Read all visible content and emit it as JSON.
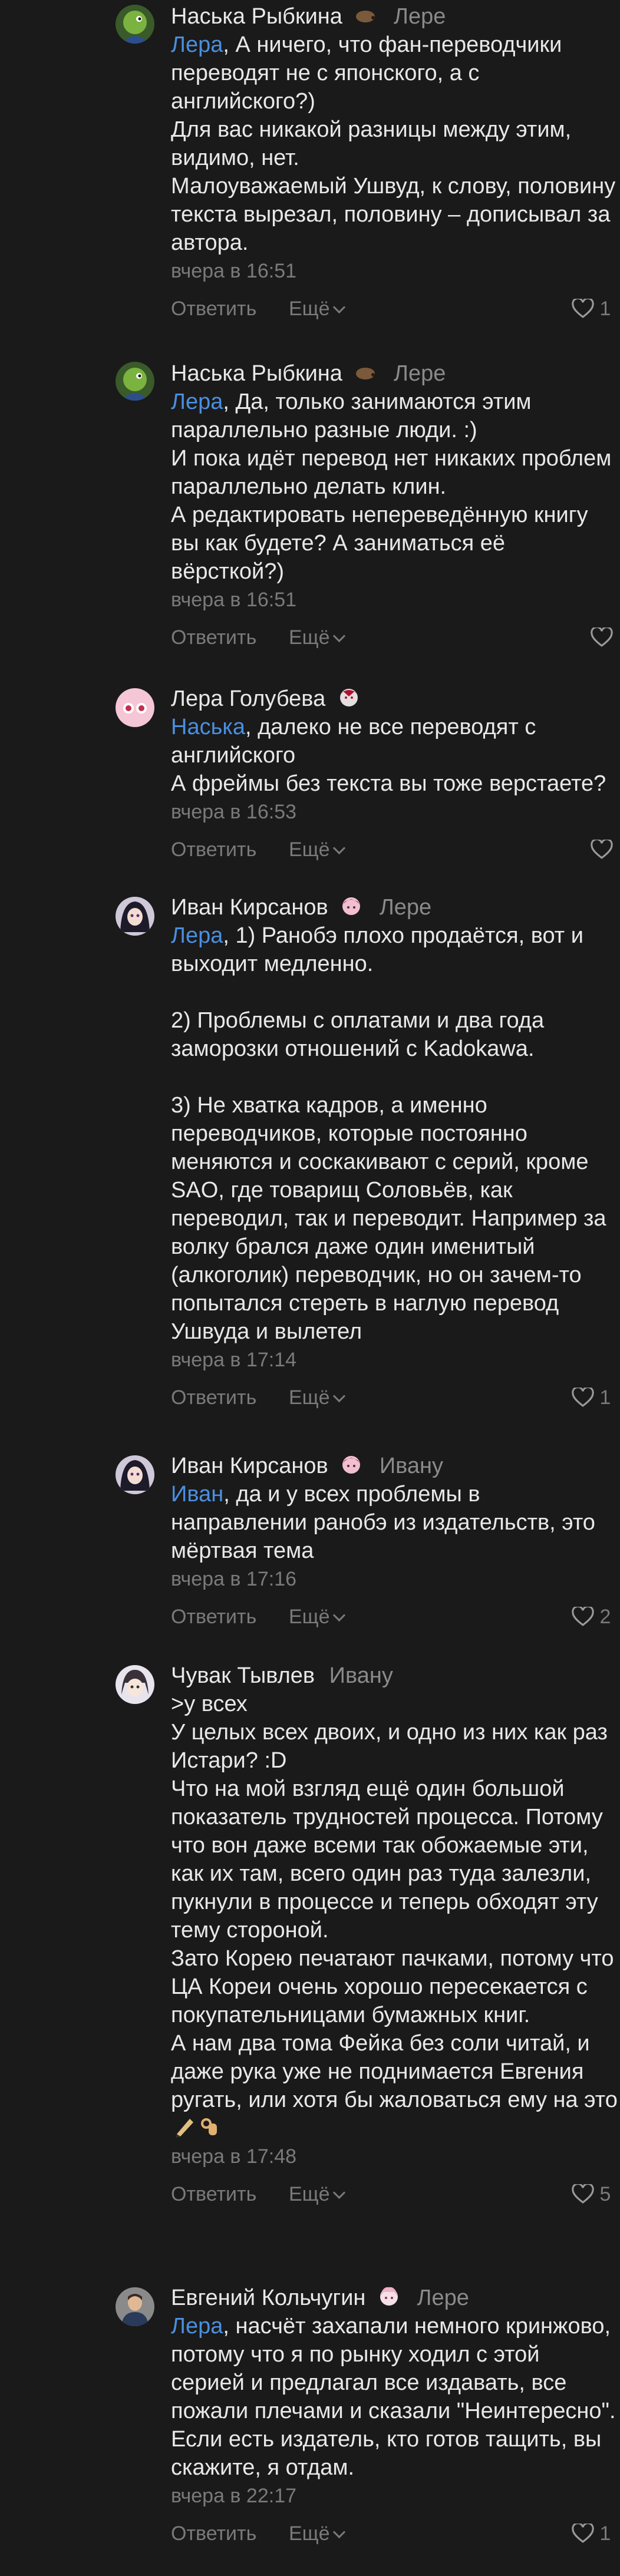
{
  "ui": {
    "reply_label": "Ответить",
    "more_label": "Ещё"
  },
  "comments": [
    {
      "author": "Наська Рыбкина",
      "reply_to": "Лере",
      "mention": "Лера",
      "text": ", А ничего, что фан-переводчики переводят не с японского, а с английского?)\nДля вас никакой разницы между этим, видимо, нет.\nМалоуважаемый Ушвуд, к слову, половину текста вырезал, половину – дописывал за автора.",
      "time": "вчера в 16:51",
      "likes": "1",
      "avatar": "green-bird"
    },
    {
      "author": "Наська Рыбкина",
      "reply_to": "Лере",
      "mention": "Лера",
      "text": ", Да, только занимаются этим параллельно разные люди. :)\nИ пока идёт перевод нет никаких проблем параллельно делать клин.\nА редактировать непереведённую книгу вы как будете? А заниматься её вёрсткой?)",
      "time": "вчера в 16:51",
      "likes": "",
      "avatar": "green-bird"
    },
    {
      "author": "Лера Голубева",
      "reply_to": "",
      "mention": "Наська",
      "text": ", далеко не все переводят с английского\nА фреймы без текста вы тоже верстаете?",
      "time": "вчера в 16:53",
      "likes": "",
      "avatar": "pink-eyes"
    },
    {
      "author": "Иван Кирсанов",
      "reply_to": "Лере",
      "mention": "Лера",
      "text": ", 1) Ранобэ плохо продаётся, вот и выходит медленно.\n\n2) Проблемы с оплатами и два года заморозки отношений с Kadokawa.\n\n3) Не хватка кадров, а именно переводчиков, которые постоянно меняются и соскакивают с серий, кроме SAO, где товарищ Соловьёв, как переводил, так и переводит. Например за волку брался даже один именитый (алкоголик) переводчик, но он зачем-то попытался стереть в наглую перевод Ушвуда и вылетел",
      "time": "вчера в 17:14",
      "likes": "1",
      "avatar": "anime-dark"
    },
    {
      "author": "Иван Кирсанов",
      "reply_to": "Ивану",
      "mention": "Иван",
      "text": ", да и у всех проблемы в направлении ранобэ из издательств, это мёртвая тема",
      "time": "вчера в 17:16",
      "likes": "2",
      "avatar": "anime-dark"
    },
    {
      "author": "Чувак Тывлев",
      "reply_to": "Ивану",
      "mention": "",
      "text": ">у всех\nУ целых всех двоих, и одно из них как раз Истари? :D\nЧто на мой взгляд ещё один большой показатель трудностей процесса. Потому что вон даже всеми так обожаемые эти, как их там, всего один раз туда залезли, пукнули в процессе и теперь обходят эту тему стороной.\nЗато Корею печатают пачками, потому что ЦА Кореи очень хорошо пересекается с покупательницами бумажных книг.\nА нам два тома Фейка без соли читай, и даже рука уже не поднимается Евгения ругать, или хотя бы жаловаться ему на это",
      "time": "вчера в 17:48",
      "likes": "5",
      "avatar": "anime-light"
    },
    {
      "author": "Евгений Кольчугин",
      "reply_to": "Лере",
      "mention": "Лера",
      "text": ", насчёт захапали немного кринжово, потому что я по рынку ходил с этой серией и предлагал все издавать, все пожали плечами и сказали \"Неинтересно\". Если есть издатель, кто готов тащить, вы скажите, я отдам.",
      "time": "вчера в 22:17",
      "likes": "1",
      "avatar": "photo"
    }
  ]
}
